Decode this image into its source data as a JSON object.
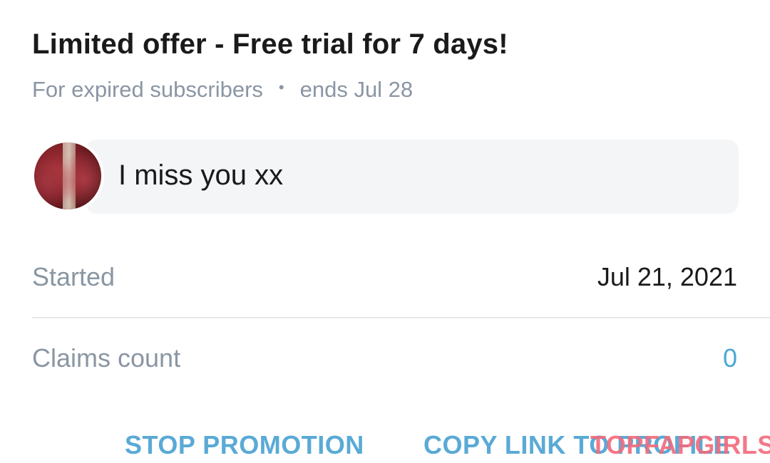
{
  "promo": {
    "title": "Limited offer - Free trial for 7 days!",
    "audience": "For expired subscribers",
    "separator": "•",
    "ends": "ends Jul 28",
    "message": "I miss you xx"
  },
  "details": {
    "started_label": "Started",
    "started_value": "Jul 21, 2021",
    "claims_label": "Claims count",
    "claims_value": "0"
  },
  "actions": {
    "stop_label": "STOP PROMOTION",
    "copy_label": "COPY LINK TO PROFILE"
  },
  "watermark": {
    "text": "TOPFAPGIRLS"
  },
  "colors": {
    "accent": "#5aaad6",
    "muted_text": "#8a96a3",
    "watermark": "#f26a7c"
  }
}
